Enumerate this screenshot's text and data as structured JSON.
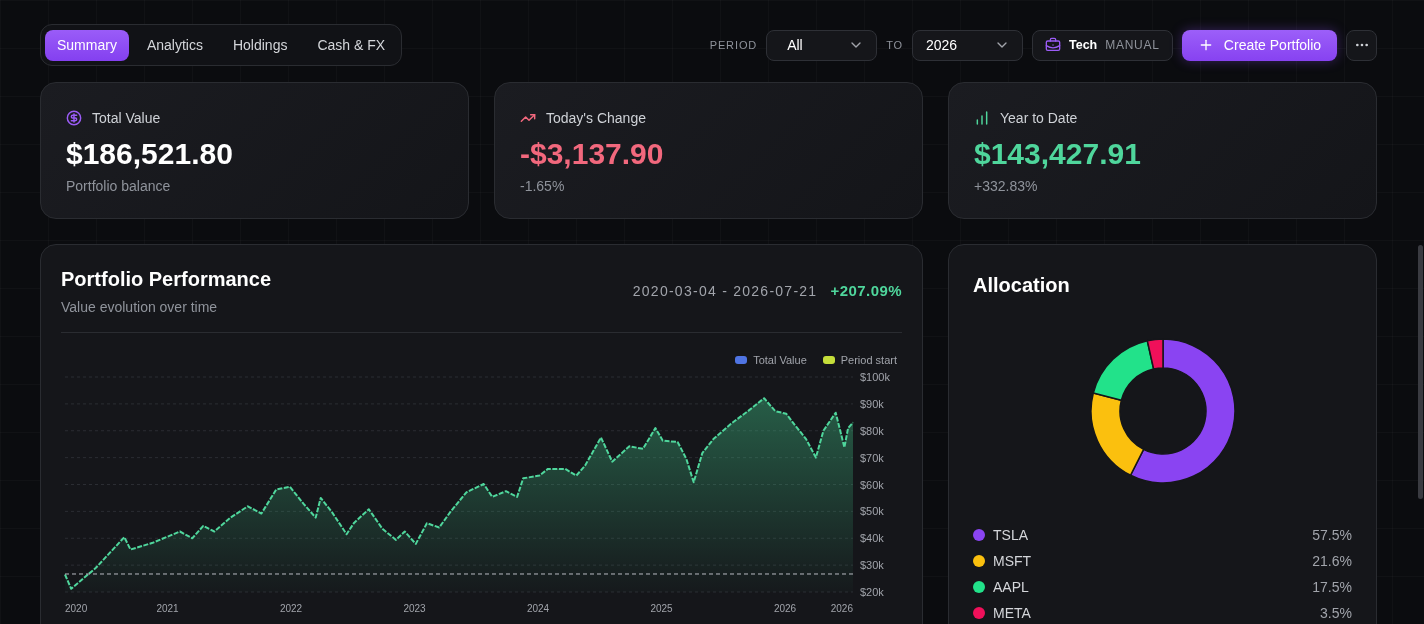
{
  "tabs": [
    {
      "label": "Summary",
      "selected": true
    },
    {
      "label": "Analytics",
      "selected": false
    },
    {
      "label": "Holdings",
      "selected": false
    },
    {
      "label": "Cash & FX",
      "selected": false
    }
  ],
  "toolbar": {
    "period_label": "PERIOD",
    "period_from": {
      "value": "All"
    },
    "to_label": "TO",
    "period_to": {
      "value": "2026"
    },
    "portfolio": {
      "name": "Tech",
      "mode": "MANUAL"
    },
    "create_button": "Create Portfolio"
  },
  "stats": [
    {
      "kind": "balance",
      "color": "#ffffff",
      "title": "Total Value",
      "value": "$186,521.80",
      "subtitle": "Portfolio balance"
    },
    {
      "kind": "change",
      "color": "#f2687d",
      "title": "Today's Change",
      "value": "-$3,137.90",
      "subtitle": "-1.65%"
    },
    {
      "kind": "ytd",
      "color": "#4fd69c",
      "title": "Year to Date",
      "value": "$143,427.91",
      "subtitle": "+332.83%"
    }
  ],
  "performance": {
    "title": "Portfolio Performance",
    "subtitle": "Value evolution over time",
    "date_range": "2020-03-04 - 2026-07-21",
    "change": "+207.09%",
    "legend": [
      {
        "color": "#4f74e3"
      },
      {
        "color": "#c5de3a"
      }
    ],
    "chart_data": {
      "type": "area",
      "grid": true,
      "x": [
        2020.17,
        2020.22,
        2020.42,
        2020.65,
        2020.7,
        2020.88,
        2021.1,
        2021.2,
        2021.29,
        2021.38,
        2021.51,
        2021.65,
        2021.76,
        2021.88,
        2021.99,
        2022.1,
        2022.2,
        2022.24,
        2022.33,
        2022.45,
        2022.51,
        2022.63,
        2022.74,
        2022.85,
        2022.92,
        2023.01,
        2023.1,
        2023.2,
        2023.29,
        2023.42,
        2023.56,
        2023.63,
        2023.74,
        2023.83,
        2023.88,
        2024.01,
        2024.08,
        2024.22,
        2024.31,
        2024.38,
        2024.51,
        2024.6,
        2024.74,
        2024.85,
        2024.95,
        2025.01,
        2025.13,
        2025.2,
        2025.26,
        2025.33,
        2025.42,
        2025.56,
        2025.7,
        2025.83,
        2025.92,
        2026.01,
        2026.08,
        2026.17,
        2026.25,
        2026.31,
        2026.41,
        2026.48,
        2026.51,
        2026.55
      ],
      "series": [
        {
          "name": "Total Value",
          "color": "#4fd69c",
          "values": [
            26500,
            21200,
            29000,
            40400,
            35800,
            38300,
            42500,
            40000,
            44600,
            42500,
            47700,
            51900,
            49200,
            58100,
            59200,
            52900,
            47700,
            55000,
            49800,
            41500,
            45700,
            50800,
            43500,
            39400,
            42500,
            37900,
            45600,
            44000,
            49800,
            57100,
            60200,
            55400,
            57500,
            55400,
            62300,
            63300,
            65800,
            65800,
            63300,
            67000,
            77500,
            68500,
            74200,
            73300,
            81000,
            76300,
            75800,
            69600,
            60800,
            71700,
            76900,
            82500,
            87300,
            92100,
            87300,
            86300,
            82100,
            76900,
            70000,
            80000,
            86700,
            73800,
            81000,
            83100
          ]
        }
      ],
      "xlim": [
        2020.17,
        2026.55
      ],
      "ylim": [
        20000,
        100000
      ],
      "xticks": [
        {
          "value": 2020.17,
          "label": "2020"
        },
        {
          "value": 2021,
          "label": "2021"
        },
        {
          "value": 2022,
          "label": "2022"
        },
        {
          "value": 2023,
          "label": "2023"
        },
        {
          "value": 2024,
          "label": "2024"
        },
        {
          "value": 2025,
          "label": "2025"
        },
        {
          "value": 2026,
          "label": "2026"
        },
        {
          "value": 2026.46,
          "label": "2026"
        }
      ],
      "yticks": [
        {
          "value": 20000,
          "label": "$20k"
        },
        {
          "value": 30000,
          "label": "$30k"
        },
        {
          "value": 40000,
          "label": "$40k"
        },
        {
          "value": 50000,
          "label": "$50k"
        },
        {
          "value": 60000,
          "label": "$60k"
        },
        {
          "value": 70000,
          "label": "$70k"
        },
        {
          "value": 80000,
          "label": "$80k"
        },
        {
          "value": 90000,
          "label": "$90k"
        },
        {
          "value": 100000,
          "label": "$100k"
        }
      ],
      "ref_lines": [
        {
          "axis": "y",
          "value": 26700,
          "label": "Period start",
          "color": "#b9bcc3"
        }
      ]
    }
  },
  "allocation": {
    "title": "Allocation",
    "items": [
      {
        "percent": "57.5%",
        "color": "#8a44f2"
      },
      {
        "percent": "21.6%",
        "color": "#fbc00e"
      },
      {
        "percent": "17.5%",
        "color": "#22e28a"
      },
      {
        "percent": "3.5%",
        "color": "#f0105a"
      }
    ],
    "chart_data": {
      "type": "donut",
      "categories": [
        "TSLA",
        "MSFT",
        "AAPL",
        "META"
      ],
      "values": [
        57.5,
        21.6,
        17.5,
        3.5
      ]
    }
  }
}
